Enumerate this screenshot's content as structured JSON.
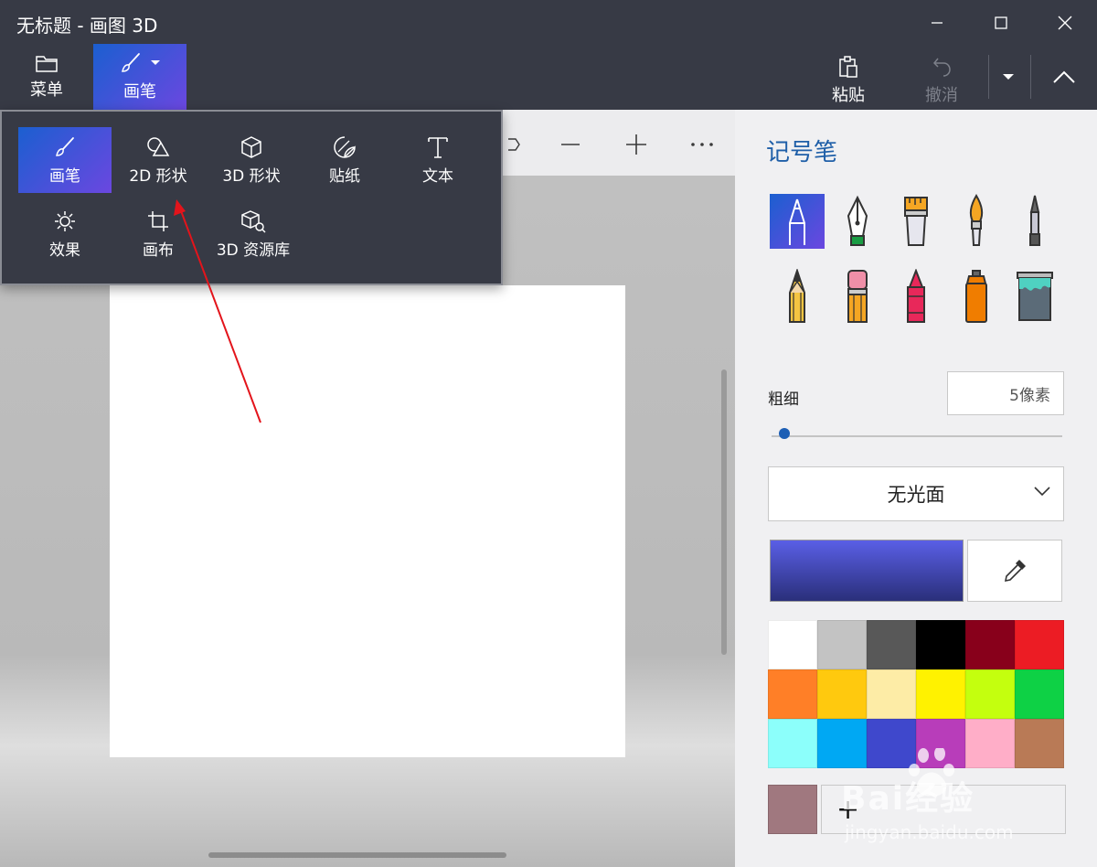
{
  "window": {
    "title": "无标题 - 画图 3D"
  },
  "toolbar": {
    "menu_label": "菜单",
    "brushes_label": "画笔",
    "paste_label": "粘贴",
    "undo_label": "撤消"
  },
  "dropdown": {
    "items": [
      {
        "label": "画笔",
        "icon": "brush-icon",
        "selected": true
      },
      {
        "label": "2D 形状",
        "icon": "shapes-2d-icon"
      },
      {
        "label": "3D 形状",
        "icon": "cube-icon"
      },
      {
        "label": "贴纸",
        "icon": "sticker-icon"
      },
      {
        "label": "文本",
        "icon": "text-icon"
      },
      {
        "label": "效果",
        "icon": "sun-icon"
      },
      {
        "label": "画布",
        "icon": "canvas-crop-icon"
      },
      {
        "label": "3D 资源库",
        "icon": "library-3d-icon"
      }
    ]
  },
  "panel": {
    "title": "记号笔",
    "tools": [
      "marker-icon",
      "calligraphy-pen-icon",
      "oil-brush-icon",
      "watercolor-icon",
      "pixel-pen-icon",
      "pencil-icon",
      "eraser-icon",
      "crayon-icon",
      "spray-can-icon",
      "fill-bucket-icon"
    ],
    "thickness_label": "粗细",
    "thickness_value": "5像素",
    "finish_value": "无光面",
    "current_color": [
      "#5a5fe6",
      "#2a2f7a"
    ],
    "palette": [
      "#ffffff",
      "#c3c3c3",
      "#585858",
      "#000000",
      "#88001b",
      "#ec1c24",
      "#ff7f27",
      "#ffc90e",
      "#fdeca6",
      "#fff200",
      "#c4ff0e",
      "#0ed145",
      "#8cfffb",
      "#00a8f3",
      "#3f48cc",
      "#b83dba",
      "#ffaec8",
      "#b97a56"
    ],
    "custom_color": "#a0787f",
    "add_color_symbol": "+"
  },
  "watermark": {
    "brand": "Bai经验",
    "url": "jingyan.baidu.com"
  }
}
